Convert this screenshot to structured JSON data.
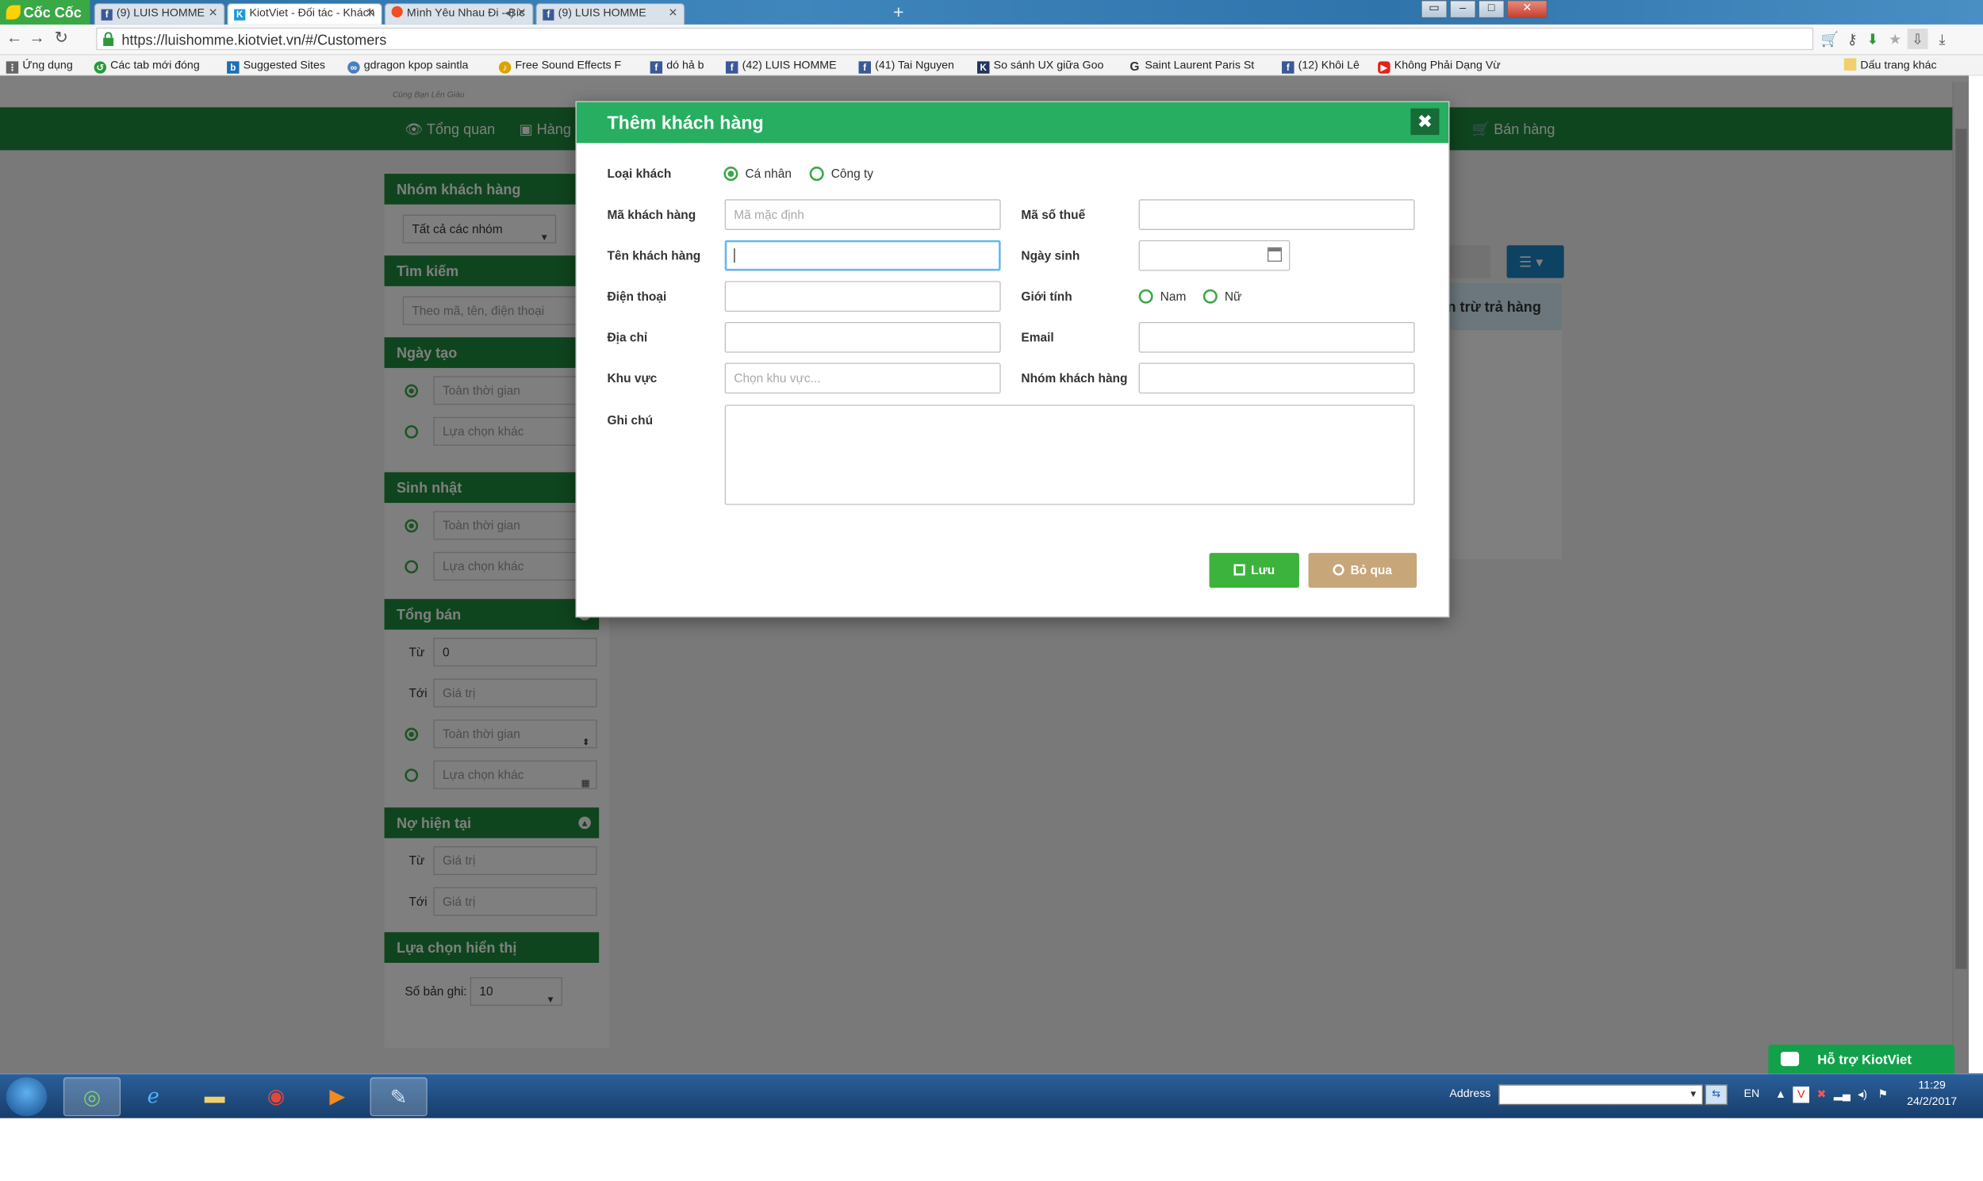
{
  "browser": {
    "brand": "Cốc Cốc",
    "tabs": [
      {
        "label": "(9) LUIS HOMME",
        "icon": "facebook-icon"
      },
      {
        "label": "KiotViet - Đối tác - Khách",
        "icon": "kiotviet-icon"
      },
      {
        "label": "Mình Yêu Nhau Đi - Bíc",
        "icon": "coccoc-music-icon"
      },
      {
        "label": "(9) LUIS HOMME",
        "icon": "facebook-icon"
      }
    ],
    "url": "https://luishomme.kiotviet.vn/#/Customers",
    "bookmarks": [
      "Ứng dụng",
      "Các tab mới đóng",
      "Suggested Sites",
      "gdragon kpop saintla",
      "Free Sound Effects F",
      "dó hả b",
      "(42) LUIS HOMME",
      "(41) Tai Nguyen",
      "So sánh UX giữa Goo",
      "Saint Laurent Paris St",
      "(12) Khôi Lê",
      "Không Phải Dạng Vừ"
    ],
    "other_bookmarks": "Dấu trang khác"
  },
  "app": {
    "slogan": "Cùng Bạn Lên Giàu",
    "nav": {
      "overview": "Tổng quan",
      "goods": "Hàng",
      "sales": "Bán hàng"
    },
    "column_header": "ản trừ trả hàng",
    "sidebar": {
      "customer_group": {
        "title": "Nhóm khách hàng",
        "select_value": "Tất cả các nhóm"
      },
      "search": {
        "title": "Tìm kiếm",
        "placeholder": "Theo mã, tên, điện thoại"
      },
      "created_date": {
        "title": "Ngày tạo",
        "option_all": "Toàn thời gian",
        "option_custom": "Lựa chọn khác"
      },
      "birthday": {
        "title": "Sinh nhật",
        "option_all": "Toàn thời gian",
        "option_custom": "Lựa chọn khác"
      },
      "total_sales": {
        "title": "Tổng bán",
        "from_label": "Từ",
        "from_value": "0",
        "to_label": "Tới",
        "to_placeholder": "Giá trị",
        "option_all": "Toàn thời gian",
        "option_custom": "Lựa chọn khác"
      },
      "current_debt": {
        "title": "Nợ hiện tại",
        "from_label": "Từ",
        "from_placeholder": "Giá trị",
        "to_label": "Tới",
        "to_placeholder": "Giá trị"
      },
      "display_options": {
        "title": "Lựa chọn hiển thị",
        "records_label": "Số bản ghi:",
        "records_value": "10"
      }
    }
  },
  "modal": {
    "title": "Thêm khách hàng",
    "customer_type_label": "Loại khách",
    "type_individual": "Cá nhân",
    "type_company": "Công ty",
    "code_label": "Mã khách hàng",
    "code_placeholder": "Mã mặc định",
    "tax_code_label": "Mã số thuế",
    "name_label": "Tên khách hàng",
    "birthday_label": "Ngày sinh",
    "phone_label": "Điện thoại",
    "gender_label": "Giới tính",
    "gender_male": "Nam",
    "gender_female": "Nữ",
    "address_label": "Địa chỉ",
    "email_label": "Email",
    "area_label": "Khu vực",
    "area_placeholder": "Chọn khu vực...",
    "group_label": "Nhóm khách hàng",
    "note_label": "Ghi chú",
    "save_label": "Lưu",
    "cancel_label": "Bỏ qua"
  },
  "support_button": "Hỗ trợ KiotViet",
  "taskbar": {
    "address_label": "Address",
    "language": "EN",
    "time": "11:29",
    "date": "24/2/2017"
  },
  "colors": {
    "brand_green": "#1e8a3c",
    "modal_header": "#27ae60",
    "save_button": "#3cb33c",
    "cancel_button": "#c7a67a",
    "radio_accent": "#3aa84a"
  }
}
